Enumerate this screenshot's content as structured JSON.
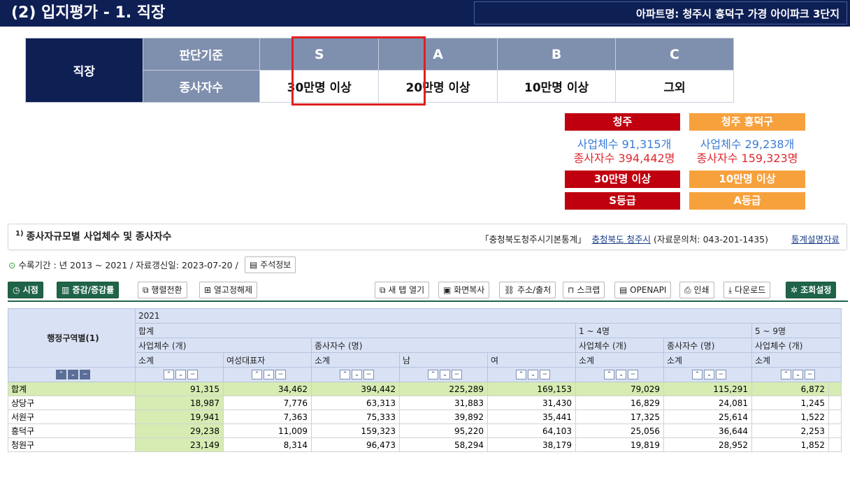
{
  "header": {
    "title": "(2) 입지평가 - 1. 직장",
    "apartment": "아파트명: 청주시 흥덕구 가경 아이파크 3단지"
  },
  "grade_table": {
    "category": "직장",
    "row1_label": "판단기준",
    "row2_label": "종사자수",
    "grades": [
      "S",
      "A",
      "B",
      "C"
    ],
    "thresholds": [
      "30만명 이상",
      "20만명 이상",
      "10만명 이상",
      "그외"
    ]
  },
  "cheongju": {
    "name": "청주",
    "biz": "사업체수 91,315개",
    "workers": "종사자수 394,442명",
    "threshold": "30만명 이상",
    "grade": "S등급"
  },
  "heungdeok": {
    "name": "청주 흥덕구",
    "biz": "사업체수 29,238개",
    "workers": "종사자수 159,323명",
    "threshold": "10만명 이상",
    "grade": "A등급"
  },
  "colors": {
    "navy": "#0e1f54",
    "red": "#c0000e",
    "orange": "#f7a13d",
    "green": "#1f6448"
  },
  "kosis": {
    "note_num": "1)",
    "title": "종사자규모별 사업체수 및 종사자수",
    "source": "「충청북도청주시기본통계」",
    "org": "충청북도 청주시",
    "contact": " (자료문의처: 043-201-1435)",
    "link": "통계설명자료",
    "period": "수록기간 : 년 2013 ~ 2021 / 자료갱신일: 2023-07-20 /",
    "note_button": "주석정보"
  },
  "toolbar": {
    "left": [
      "시점",
      "증감/증감률",
      "행렬전환",
      "열고정해제"
    ],
    "right": [
      "새 탭 열기",
      "화면복사",
      "주소/출처",
      "스크랩",
      "OPENAPI",
      "인쇄",
      "다운로드",
      "조회설정"
    ]
  },
  "table": {
    "row_header": "행정구역별(1)",
    "year": "2021",
    "group_total": "합계",
    "group_1_4": "1 ~ 4명",
    "group_5_9": "5 ~ 9명",
    "biz_label": "사업체수 (개)",
    "workers_label": "종사자수 (명)",
    "sub": {
      "subtotal": "소계",
      "female_rep": "여성대표자",
      "male": "남",
      "female": "여"
    },
    "rows": [
      {
        "name": "합계",
        "values": [
          "91,315",
          "34,462",
          "394,442",
          "225,289",
          "169,153",
          "79,029",
          "115,291",
          "6,872"
        ]
      },
      {
        "name": "상당구",
        "values": [
          "18,987",
          "7,776",
          "63,313",
          "31,883",
          "31,430",
          "16,829",
          "24,081",
          "1,245"
        ]
      },
      {
        "name": "서원구",
        "values": [
          "19,941",
          "7,363",
          "75,333",
          "39,892",
          "35,441",
          "17,325",
          "25,614",
          "1,522"
        ]
      },
      {
        "name": "흥덕구",
        "values": [
          "29,238",
          "11,009",
          "159,323",
          "95,220",
          "64,103",
          "25,056",
          "36,644",
          "2,253"
        ]
      },
      {
        "name": "청원구",
        "values": [
          "23,149",
          "8,314",
          "96,473",
          "58,294",
          "38,179",
          "19,819",
          "28,952",
          "1,852"
        ]
      }
    ]
  }
}
